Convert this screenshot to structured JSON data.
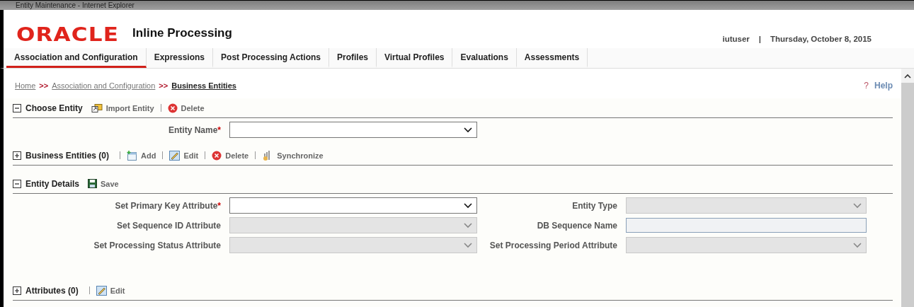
{
  "window": {
    "title": "Entity Maintenance - Internet Explorer"
  },
  "header": {
    "logo": "ORACLE",
    "product": "Inline Processing",
    "user": "iutuser",
    "separator": "|",
    "date": "Thursday, October 8, 2015"
  },
  "tabs": [
    {
      "label": "Association and Configuration",
      "selected": true
    },
    {
      "label": "Expressions",
      "selected": false
    },
    {
      "label": "Post Processing Actions",
      "selected": false
    },
    {
      "label": "Profiles",
      "selected": false
    },
    {
      "label": "Virtual Profiles",
      "selected": false
    },
    {
      "label": "Evaluations",
      "selected": false
    },
    {
      "label": "Assessments",
      "selected": false
    }
  ],
  "breadcrumb": {
    "items": [
      {
        "label": "Home",
        "current": false
      },
      {
        "label": "Association and Configuration",
        "current": false
      },
      {
        "label": "Business Entities",
        "current": true
      }
    ],
    "separator": ">>"
  },
  "help": {
    "icon": "?",
    "label": "Help"
  },
  "sections": [
    {
      "title": "Choose Entity",
      "expanded": true,
      "actions": [
        {
          "kind": "import",
          "label": "Import Entity"
        },
        {
          "kind": "delete",
          "label": "Delete"
        }
      ],
      "fields": [
        {
          "label": "Entity Name",
          "required_mark": "*",
          "kind": "select",
          "disabled": false
        }
      ]
    },
    {
      "title": "Business Entities (0)",
      "expanded": false,
      "actions": [
        {
          "kind": "add",
          "label": "Add"
        },
        {
          "kind": "edit",
          "label": "Edit"
        },
        {
          "kind": "delete",
          "label": "Delete"
        },
        {
          "kind": "sync",
          "label": "Synchronize"
        }
      ]
    },
    {
      "title": "Entity Details",
      "expanded": true,
      "actions": [
        {
          "kind": "save",
          "label": "Save"
        }
      ],
      "fields": [
        {
          "label": "Set Primary Key Attribute",
          "required_mark": "*",
          "kind": "select",
          "disabled": false
        },
        {
          "label": "Entity Type",
          "kind": "select",
          "disabled": true
        },
        {
          "label": "Set Sequence ID Attribute",
          "kind": "select",
          "disabled": true
        },
        {
          "label": "DB Sequence Name",
          "kind": "text"
        },
        {
          "label": "Set Processing Status Attribute",
          "kind": "select",
          "disabled": true
        },
        {
          "label": "Set Processing Period Attribute",
          "kind": "select",
          "disabled": true
        }
      ]
    },
    {
      "title": "Attributes (0)",
      "expanded": false,
      "actions": [
        {
          "kind": "edit",
          "label": "Edit"
        }
      ]
    }
  ]
}
